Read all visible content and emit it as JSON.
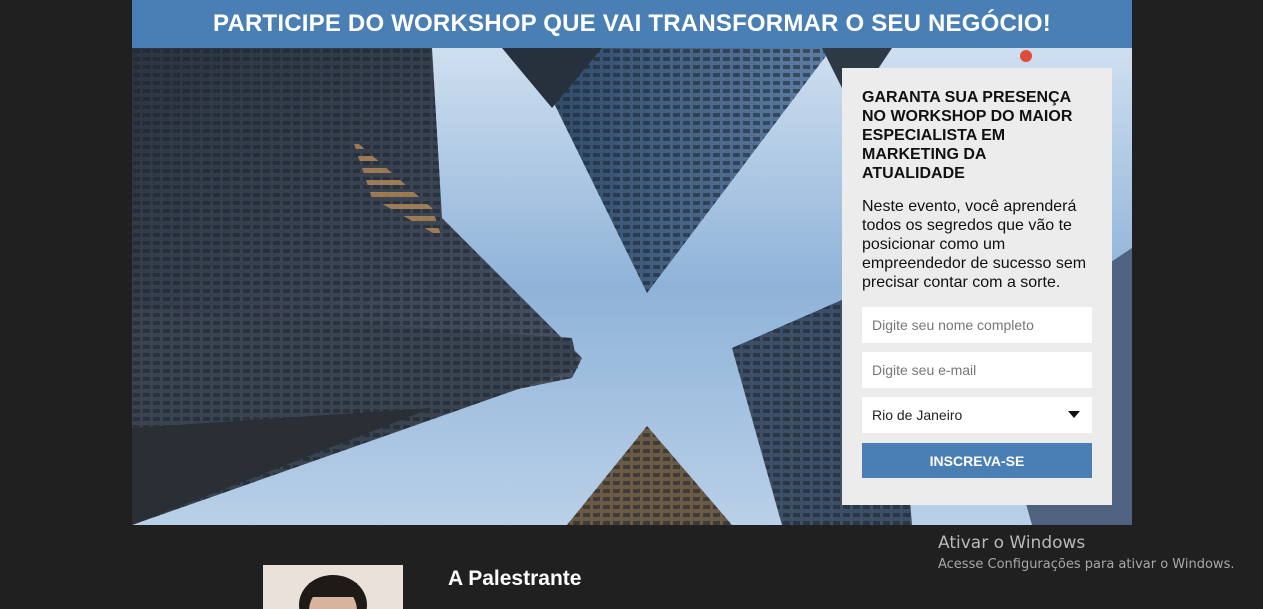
{
  "banner": {
    "title": "PARTICIPE DO WORKSHOP QUE VAI TRANSFORMAR O SEU NEGÓCIO!",
    "background": "#4a7fb5"
  },
  "hero": {
    "image": "skyscrapers-looking-up"
  },
  "signup": {
    "title": "GARANTA SUA PRESENÇA NO WORKSHOP DO MAIOR ESPECIALISTA EM MARKETING DA ATUALIDADE",
    "description": "Neste evento, você aprenderá todos os segredos que vão te posicionar como um empreendedor de sucesso sem precisar contar com a sorte.",
    "name_placeholder": "Digite seu nome completo",
    "name_value": "",
    "email_placeholder": "Digite seu e-mail",
    "email_value": "",
    "city_selected": "Rio de Janeiro",
    "submit_label": "INSCREVA-SE",
    "accent": "#4a7fb5"
  },
  "speaker": {
    "heading": "A Palestrante"
  },
  "watermark": {
    "title": "Ativar o Windows",
    "subtitle": "Acesse Configurações para ativar o Windows."
  }
}
